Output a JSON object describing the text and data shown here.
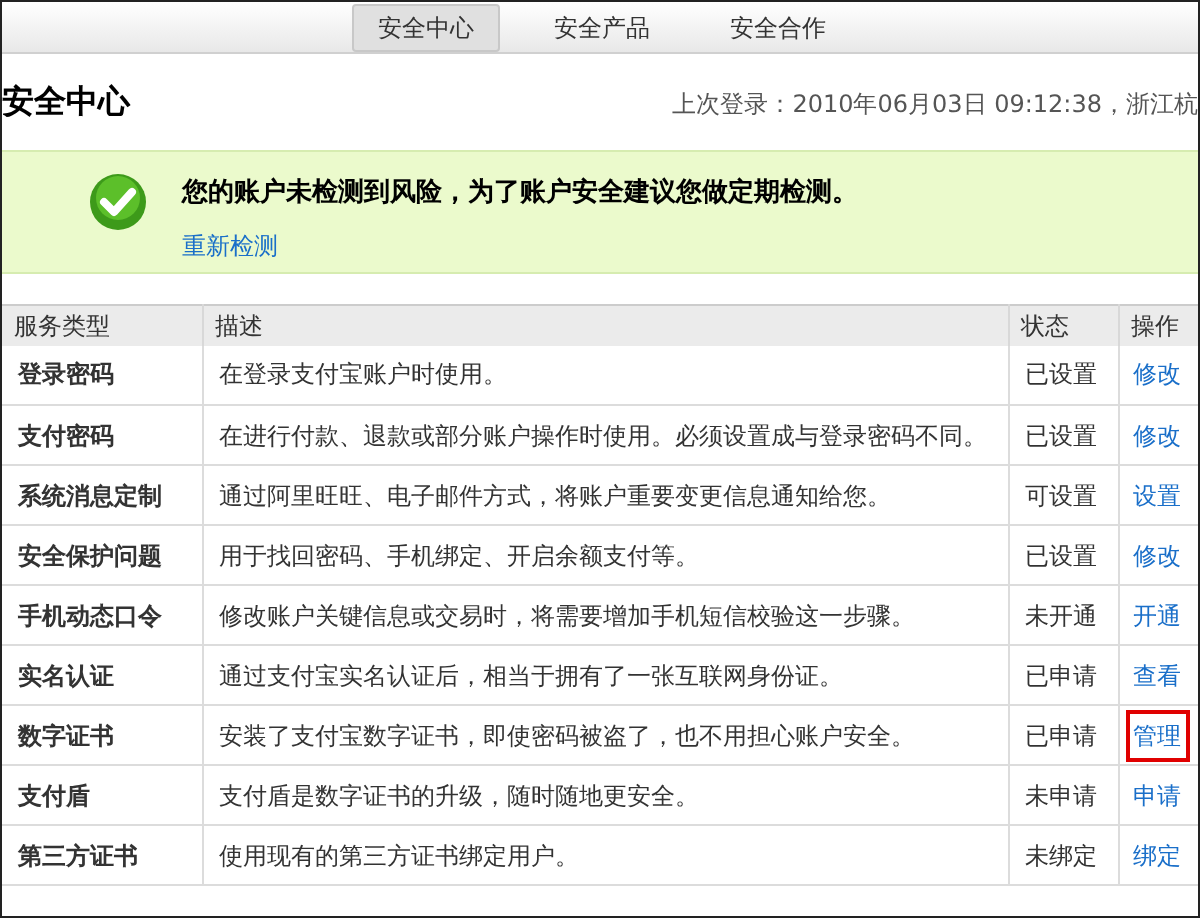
{
  "nav_tabs": [
    {
      "label": "安全中心",
      "selected": true
    },
    {
      "label": "安全产品",
      "selected": false
    },
    {
      "label": "安全合作",
      "selected": false
    }
  ],
  "page_title": "安全中心",
  "last_login": "上次登录：2010年06月03日 09:12:38，浙江杭",
  "notice": {
    "message": "您的账户未检测到风险，为了账户安全建议您做定期检测。",
    "link": "重新检测"
  },
  "table": {
    "columns": [
      "服务类型",
      "描述",
      "状态",
      "操作"
    ],
    "rows": [
      {
        "service": "登录密码",
        "description": "在登录支付宝账户时使用。",
        "status": "已设置",
        "action": "修改",
        "highlighted": false
      },
      {
        "service": "支付密码",
        "description": "在进行付款、退款或部分账户操作时使用。必须设置成与登录密码不同。",
        "status": "已设置",
        "action": "修改",
        "highlighted": false
      },
      {
        "service": "系统消息定制",
        "description": "通过阿里旺旺、电子邮件方式，将账户重要变更信息通知给您。",
        "status": "可设置",
        "action": "设置",
        "highlighted": false
      },
      {
        "service": "安全保护问题",
        "description": "用于找回密码、手机绑定、开启余额支付等。",
        "status": "已设置",
        "action": "修改",
        "highlighted": false
      },
      {
        "service": "手机动态口令",
        "description": "修改账户关键信息或交易时，将需要增加手机短信校验这一步骤。",
        "status": "未开通",
        "action": "开通",
        "highlighted": false
      },
      {
        "service": "实名认证",
        "description": "通过支付宝实名认证后，相当于拥有了一张互联网身份证。",
        "status": "已申请",
        "action": "查看",
        "highlighted": false
      },
      {
        "service": "数字证书",
        "description": "安装了支付宝数字证书，即使密码被盗了，也不用担心账户安全。",
        "status": "已申请",
        "action": "管理",
        "highlighted": true
      },
      {
        "service": "支付盾",
        "description": "支付盾是数字证书的升级，随时随地更安全。",
        "status": "未申请",
        "action": "申请",
        "highlighted": false
      },
      {
        "service": "第三方证书",
        "description": "使用现有的第三方证书绑定用户。",
        "status": "未绑定",
        "action": "绑定",
        "highlighted": false
      }
    ]
  }
}
